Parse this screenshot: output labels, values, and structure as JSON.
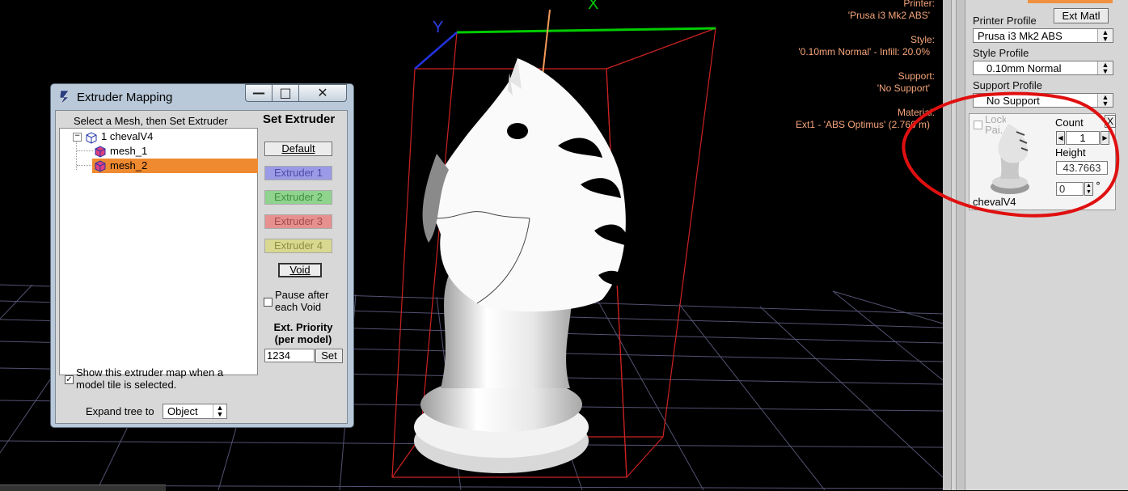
{
  "viewport": {
    "axis_x_label": "X",
    "axis_y_label": "Y",
    "info": {
      "printer_label": "Printer:",
      "printer_value": "'Prusa i3 Mk2 ABS'",
      "style_label": "Style:",
      "style_value": "'0.10mm Normal' - Infill: 20.0%",
      "support_label": "Support:",
      "support_value": "'No Support'",
      "material_label": "Material:",
      "material_value": "Ext1 - 'ABS Optimus' (2.766 m)"
    },
    "colors": {
      "info_text": "#f5a57a",
      "x_axis": "#00cc00",
      "y_axis": "#2233dd",
      "bbox": "#cc2222",
      "grid": "#6a6a8a"
    }
  },
  "sidepanel": {
    "ext_matl_button": "Ext Matl",
    "printer_profile_label": "Printer Profile",
    "printer_profile_value": "Prusa i3 Mk2 ABS",
    "style_profile_label": "Style Profile",
    "style_profile_value": "0.10mm Normal",
    "support_profile_label": "Support Profile",
    "support_profile_value": "No Support",
    "tile": {
      "lock_label": "Lock Pai...",
      "count_label": "Count",
      "count_value": "1",
      "height_label": "Height",
      "height_value": "43.7663",
      "rotate_value": "0",
      "close_label": "X",
      "model_name": "chevalV4",
      "degree_symbol": "°"
    }
  },
  "dialog": {
    "title": "Extruder Mapping",
    "tree_header": "Select a Mesh, then Set Extruder",
    "tree": [
      {
        "label": "1 chevalV4",
        "level": 0,
        "selected": false
      },
      {
        "label": "mesh_1",
        "level": 1,
        "selected": false
      },
      {
        "label": "mesh_2",
        "level": 1,
        "selected": true
      }
    ],
    "set_extruder_heading": "Set Extruder",
    "buttons": {
      "default": "Default",
      "extruder1": "Extruder 1",
      "extruder2": "Extruder 2",
      "extruder3": "Extruder 3",
      "extruder4": "Extruder 4",
      "void": "Void",
      "set": "Set"
    },
    "pause_label": "Pause after each Void",
    "priority_heading": "Ext. Priority (per model)",
    "priority_value": "1234",
    "show_map_label": "Show this extruder map when a model tile is selected.",
    "expand_label": "Expand tree to",
    "expand_value": "Object",
    "colors": {
      "selection": "#f08a30",
      "ext1": "#9a9ae6",
      "ext2": "#8fd38f",
      "ext3": "#e69090",
      "ext4": "#d8d890"
    }
  }
}
